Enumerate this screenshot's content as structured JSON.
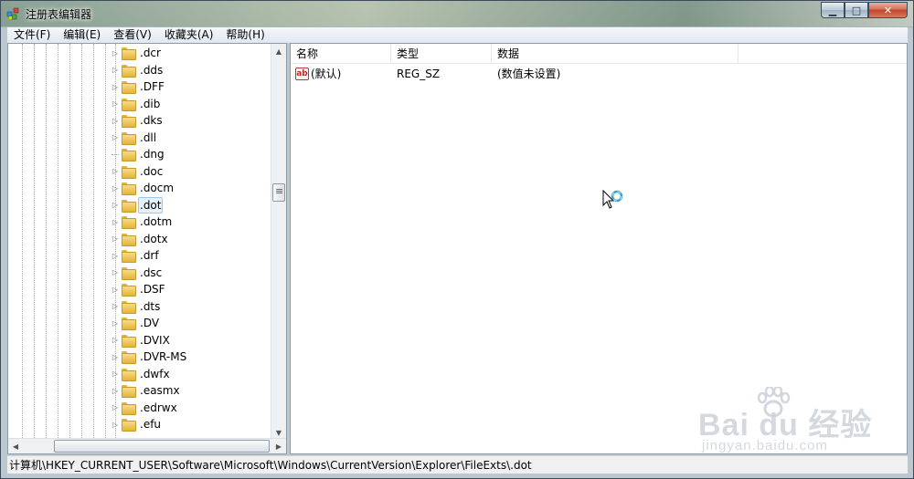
{
  "window": {
    "title": "注册表编辑器"
  },
  "menu": [
    "文件(F)",
    "编辑(E)",
    "查看(V)",
    "收藏夹(A)",
    "帮助(H)"
  ],
  "tree": {
    "items": [
      {
        "label": ".dcr",
        "expandable": true
      },
      {
        "label": ".dds",
        "expandable": true
      },
      {
        "label": ".DFF",
        "expandable": true
      },
      {
        "label": ".dib",
        "expandable": true
      },
      {
        "label": ".dks",
        "expandable": true
      },
      {
        "label": ".dll",
        "expandable": true
      },
      {
        "label": ".dng",
        "expandable": false
      },
      {
        "label": ".doc",
        "expandable": true
      },
      {
        "label": ".docm",
        "expandable": true
      },
      {
        "label": ".dot",
        "expandable": true,
        "selected": true
      },
      {
        "label": ".dotm",
        "expandable": true
      },
      {
        "label": ".dotx",
        "expandable": true
      },
      {
        "label": ".drf",
        "expandable": true
      },
      {
        "label": ".dsc",
        "expandable": true
      },
      {
        "label": ".DSF",
        "expandable": true
      },
      {
        "label": ".dts",
        "expandable": true
      },
      {
        "label": ".DV",
        "expandable": true
      },
      {
        "label": ".DVIX",
        "expandable": true
      },
      {
        "label": ".DVR-MS",
        "expandable": true
      },
      {
        "label": ".dwfx",
        "expandable": true
      },
      {
        "label": ".easmx",
        "expandable": true
      },
      {
        "label": ".edrwx",
        "expandable": true
      },
      {
        "label": ".efu",
        "expandable": true
      }
    ]
  },
  "values": {
    "columns": [
      "名称",
      "类型",
      "数据"
    ],
    "rows": [
      {
        "name": "(默认)",
        "type": "REG_SZ",
        "data": "(数值未设置)"
      }
    ]
  },
  "status": {
    "path": "计算机\\HKEY_CURRENT_USER\\Software\\Microsoft\\Windows\\CurrentVersion\\Explorer\\FileExts\\.dot"
  },
  "watermark": {
    "brand": "Bai du 经验",
    "url": "jingyan.baidu.com"
  }
}
